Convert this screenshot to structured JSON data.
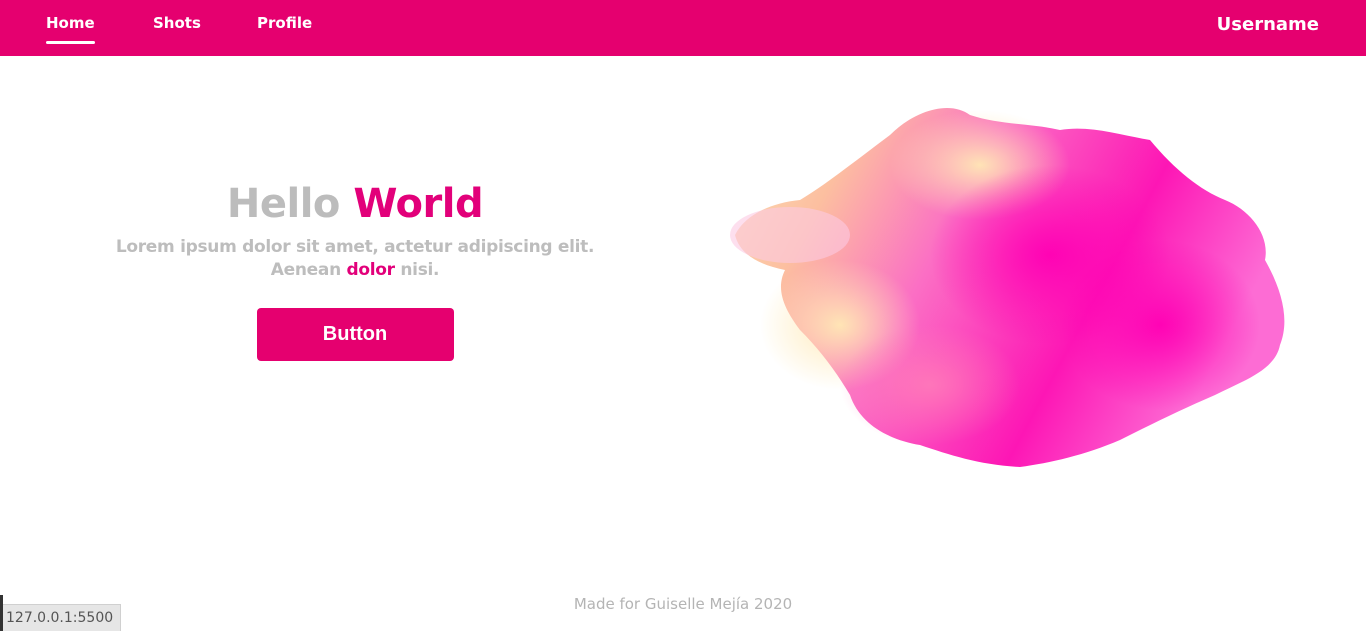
{
  "nav": {
    "items": [
      {
        "label": "Home",
        "active": true
      },
      {
        "label": "Shots",
        "active": false
      },
      {
        "label": "Profile",
        "active": false
      }
    ],
    "username": "Username"
  },
  "hero": {
    "title_part1": "Hello",
    "title_part2": "World",
    "text_line1": "Lorem ipsum dolor sit amet, actetur adipiscing elit.",
    "text_line2_before": "Aenean",
    "text_line2_highlight": "dolor",
    "text_line2_after": "nisi.",
    "button_label": "Button"
  },
  "footer": {
    "text": "Made for Guiselle Mejía 2020"
  },
  "status_bar": {
    "url": "127.0.0.1:5500"
  },
  "colors": {
    "brand": "#e5006f",
    "accent_text": "#e2007a",
    "muted_text": "#bcbcbc"
  }
}
